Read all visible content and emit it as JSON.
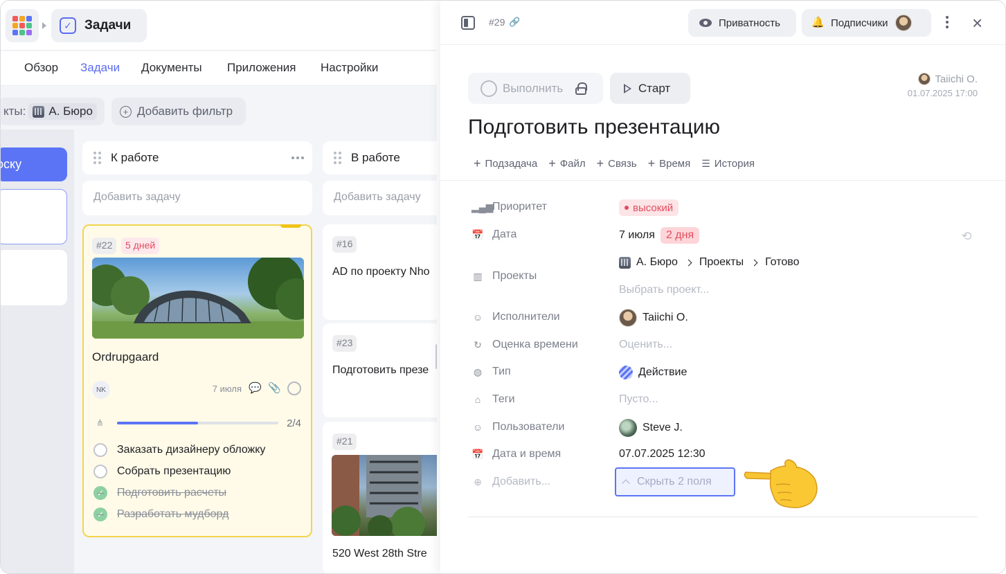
{
  "app": {
    "name": "Задачи"
  },
  "nav": {
    "tabs": [
      {
        "label": "Обзор"
      },
      {
        "label": "Задачи",
        "active": true
      },
      {
        "label": "Документы"
      },
      {
        "label": "Приложения"
      },
      {
        "label": "Настройки"
      }
    ]
  },
  "filters": {
    "projects_prefix": "кты:",
    "project_name": "А. Бюро",
    "add_filter": "Добавить фильтр"
  },
  "columns": {
    "done": {
      "title": "оску"
    },
    "todo": {
      "title": "К работе",
      "add_task": "Добавить задачу"
    },
    "in_progress": {
      "title": "В работе",
      "add_task": "Добавить задачу"
    }
  },
  "card": {
    "id": "#22",
    "due": "5 дней",
    "title": "Ordrupgaard",
    "assignee": "NK",
    "date": "7 июля",
    "progress_text": "2/4",
    "progress": 0.5,
    "checklist": [
      {
        "text": "Заказать дизайнеру обложку",
        "done": false
      },
      {
        "text": "Собрать презентацию",
        "done": false
      },
      {
        "text": "Подготовить расчеты",
        "done": true
      },
      {
        "text": "Разработать мудборд",
        "done": true
      }
    ]
  },
  "work_cards": [
    {
      "id": "#16",
      "title": "AD по проекту Nho"
    },
    {
      "id": "#23",
      "title": "Подготовить презе"
    },
    {
      "id": "#21",
      "title": "520 West 28th Stre"
    }
  ],
  "panel": {
    "task_id": "#29",
    "privacy_label": "Приватность",
    "subscribers_label": "Подписчики",
    "complete_label": "Выполнить",
    "start_label": "Старт",
    "author_name": "Taiichi O.",
    "author_time": "01.07.2025 17:00",
    "title": "Подготовить презентацию",
    "actions": [
      "Подзадача",
      "Файл",
      "Связь",
      "Время",
      "История"
    ],
    "props": {
      "priority": {
        "label": "Приоритет",
        "value": "высокий"
      },
      "date": {
        "label": "Дата",
        "value": "7 июля",
        "days": "2 дня"
      },
      "projects": {
        "label": "Проекты",
        "path": [
          "А. Бюро",
          "Проекты",
          "Готово"
        ],
        "placeholder": "Выбрать проект..."
      },
      "assignees": {
        "label": "Исполнители",
        "value": "Taiichi O."
      },
      "estimate": {
        "label": "Оценка времени",
        "value": "Оценить..."
      },
      "type": {
        "label": "Тип",
        "value": "Действие"
      },
      "tags": {
        "label": "Теги",
        "value": "Пусто..."
      },
      "users": {
        "label": "Пользователи",
        "value": "Steve J."
      },
      "datetime": {
        "label": "Дата и время",
        "value": "07.07.2025 12:30"
      },
      "add": {
        "label": "Добавить..."
      }
    },
    "hide_fields": "Скрыть 2 поля"
  },
  "colors": {
    "accent": "#5b74f5",
    "danger": "#e34c5f",
    "card_bg": "#fffbe8",
    "card_border": "#f3d44e"
  }
}
